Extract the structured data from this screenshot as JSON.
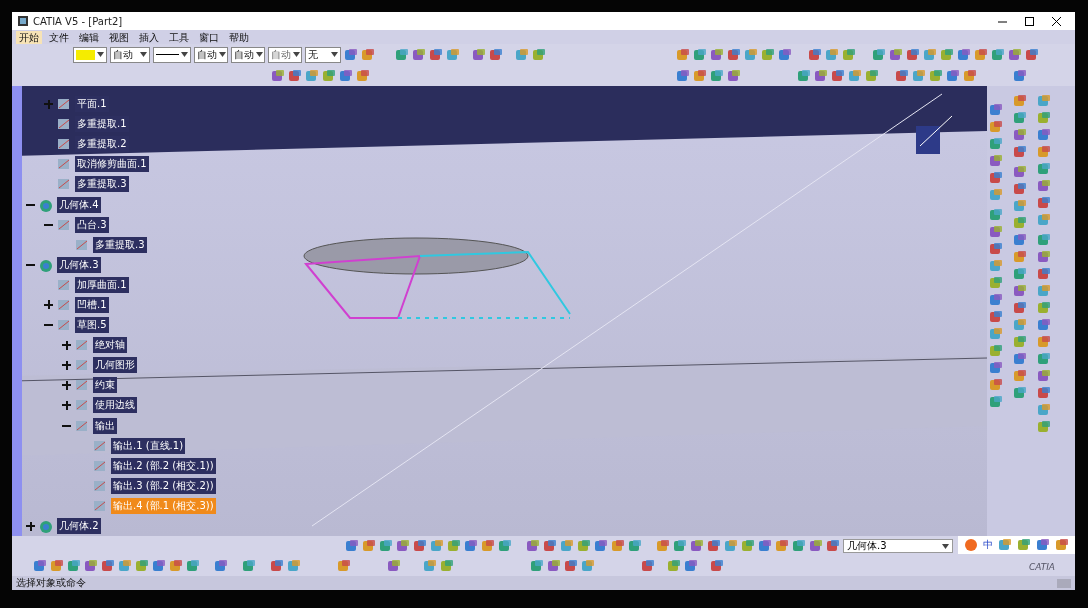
{
  "window": {
    "title": "CATIA V5 - [Part2]"
  },
  "menu": [
    {
      "label": "开始",
      "selected": true
    },
    {
      "label": "文件",
      "selected": false
    },
    {
      "label": "编辑",
      "selected": false
    },
    {
      "label": "视图",
      "selected": false
    },
    {
      "label": "插入",
      "selected": false
    },
    {
      "label": "工具",
      "selected": false
    },
    {
      "label": "窗口",
      "selected": false
    },
    {
      "label": "帮助",
      "selected": false
    }
  ],
  "format_fields": [
    {
      "kind": "color",
      "color": "#f5ec00"
    },
    {
      "kind": "text",
      "value": "自动",
      "disabled": false
    },
    {
      "kind": "line"
    },
    {
      "kind": "text",
      "value": "自动",
      "disabled": false
    },
    {
      "kind": "text",
      "value": "自动",
      "disabled": false
    },
    {
      "kind": "text",
      "value": "自动",
      "disabled": true
    },
    {
      "kind": "text",
      "value": "无",
      "disabled": false
    }
  ],
  "tree": [
    {
      "kind": "feature",
      "label": "平面.1",
      "expanded": false,
      "selected": false
    },
    {
      "kind": "feature",
      "label": "多重提取.1",
      "selected": false
    },
    {
      "kind": "feature",
      "label": "多重提取.2",
      "selected": false
    },
    {
      "kind": "feature",
      "label": "取消修剪曲面.1",
      "selected": false
    },
    {
      "kind": "feature",
      "label": "多重提取.3",
      "selected": false
    },
    {
      "kind": "body",
      "label": "几何体.4",
      "expanded": true,
      "selected": false,
      "children": [
        {
          "label": "凸台.3",
          "expanded": true,
          "selected": false,
          "children": [
            {
              "label": "多重提取.3",
              "selected": false
            }
          ]
        }
      ]
    },
    {
      "kind": "body",
      "label": "几何体.3",
      "expanded": true,
      "selected": false,
      "children": [
        {
          "label": "加厚曲面.1",
          "selected": false
        },
        {
          "label": "凹槽.1",
          "expanded": false,
          "selected": false
        },
        {
          "label": "草图.5",
          "expanded": true,
          "selected": false,
          "children": [
            {
              "label": "绝对轴",
              "expanded": false,
              "selected": false
            },
            {
              "label": "几何图形",
              "expanded": false,
              "selected": false
            },
            {
              "label": "约束",
              "expanded": false,
              "selected": false
            },
            {
              "label": "使用边线",
              "expanded": false,
              "selected": false
            },
            {
              "label": "输出",
              "expanded": true,
              "selected": false,
              "children": [
                {
                  "label": "输出.1 (直线.1)",
                  "selected": false
                },
                {
                  "label": "输出.2 (部.2 (相交.1))",
                  "selected": false
                },
                {
                  "label": "输出.3 (部.2 (相交.2))",
                  "selected": false
                },
                {
                  "label": "输出.4 (部.1 (相交.3))",
                  "selected": true
                }
              ]
            }
          ]
        }
      ]
    },
    {
      "kind": "body",
      "label": "几何体.2",
      "expanded": false,
      "selected": false
    }
  ],
  "part_selector": {
    "value": "几何体.3"
  },
  "tray": {
    "ime": "中"
  },
  "logo": "CATIA",
  "status_bar": {
    "text": "选择对象或命令"
  }
}
